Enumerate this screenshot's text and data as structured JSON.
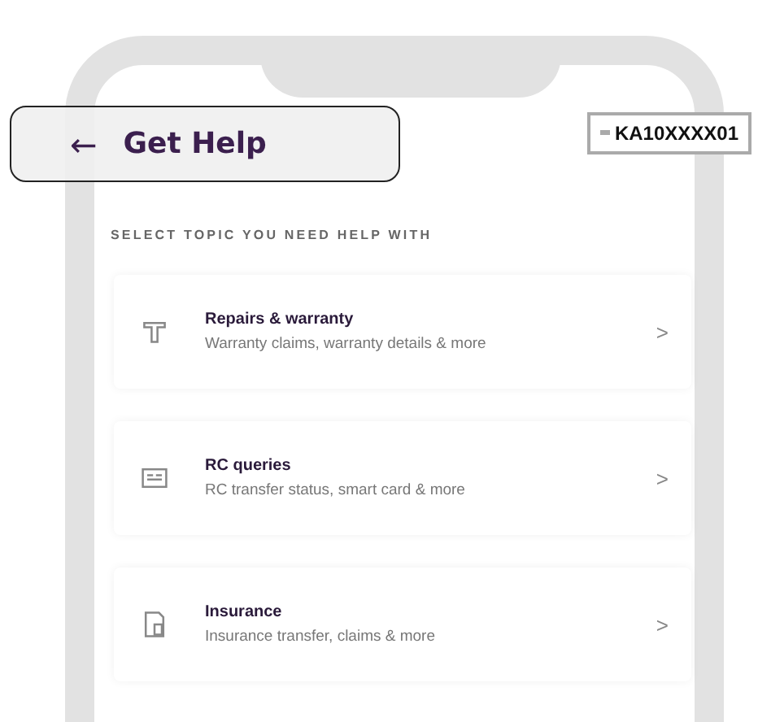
{
  "header": {
    "back_icon": "←",
    "title": "Get Help",
    "vehicle_number": "KA10XXXX01"
  },
  "section_label": "SELECT TOPIC YOU NEED HELP WITH",
  "topics": [
    {
      "kind": "repairs",
      "title": "Repairs & warranty",
      "subtitle": "Warranty claims, warranty details & more",
      "chevron": ">"
    },
    {
      "kind": "rc",
      "title": "RC queries",
      "subtitle": "RC transfer status, smart card & more",
      "chevron": ">"
    },
    {
      "kind": "insurance",
      "title": "Insurance",
      "subtitle": "Insurance transfer, claims & more",
      "chevron": ">"
    }
  ]
}
